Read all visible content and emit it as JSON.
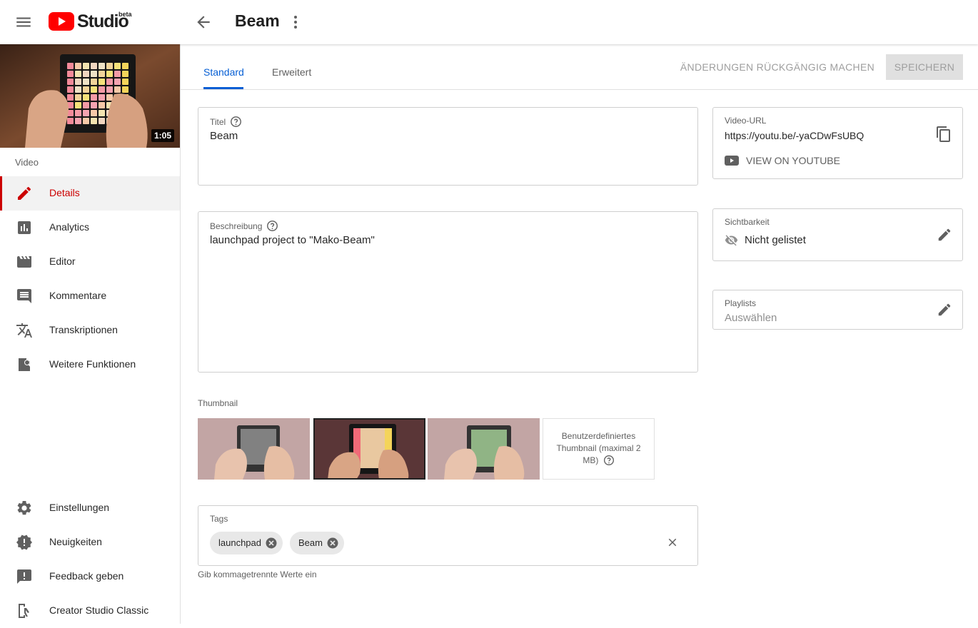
{
  "app": {
    "name": "Studio",
    "badge": "beta"
  },
  "header": {
    "page_title": "Beam"
  },
  "video": {
    "duration": "1:05"
  },
  "sidebar": {
    "section_label": "Video",
    "items": [
      {
        "label": "Details",
        "icon": "pencil-icon",
        "active": true
      },
      {
        "label": "Analytics",
        "icon": "bar-chart-icon"
      },
      {
        "label": "Editor",
        "icon": "clapperboard-icon"
      },
      {
        "label": "Kommentare",
        "icon": "comment-icon"
      },
      {
        "label": "Transkriptionen",
        "icon": "translate-icon"
      },
      {
        "label": "Weitere Funktionen",
        "icon": "features-icon"
      }
    ],
    "bottom_items": [
      {
        "label": "Einstellungen",
        "icon": "gear-icon"
      },
      {
        "label": "Neuigkeiten",
        "icon": "alert-badge-icon"
      },
      {
        "label": "Feedback geben",
        "icon": "feedback-icon"
      },
      {
        "label": "Creator Studio Classic",
        "icon": "classic-icon"
      }
    ]
  },
  "tabs": [
    {
      "label": "Standard",
      "active": true
    },
    {
      "label": "Erweitert",
      "active": false
    }
  ],
  "actions": {
    "undo_label": "ÄNDERUNGEN RÜCKGÄNGIG MACHEN",
    "save_label": "SPEICHERN"
  },
  "form": {
    "title": {
      "label": "Titel",
      "value": "Beam"
    },
    "description": {
      "label": "Beschreibung",
      "value": "launchpad project to \"Mako-Beam\""
    },
    "thumbnail": {
      "label": "Thumbnail",
      "selected_index": 1,
      "custom_label": "Benutzerdefiniertes Thumbnail (maximal 2 MB)"
    },
    "tags": {
      "label": "Tags",
      "values": [
        "launchpad",
        "Beam"
      ],
      "hint": "Gib kommagetrennte Werte ein"
    }
  },
  "right_panel": {
    "video_url": {
      "label": "Video-URL",
      "value": "https://youtu.be/-yaCDwFsUBQ",
      "link_label": "VIEW ON YOUTUBE"
    },
    "visibility": {
      "label": "Sichtbarkeit",
      "value": "Nicht gelistet"
    },
    "playlists": {
      "label": "Playlists",
      "placeholder": "Auswählen"
    }
  },
  "colors": {
    "accent_red": "#cc0000",
    "tab_blue": "#065fd4",
    "logo_red": "#ff0000"
  }
}
